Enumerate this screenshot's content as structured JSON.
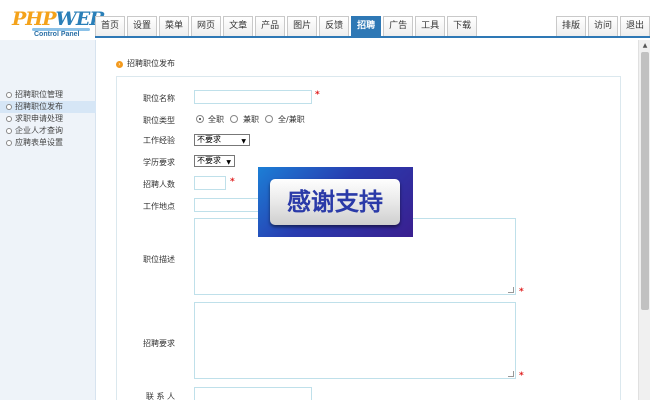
{
  "logo": {
    "main_a": "PHP",
    "main_b": "WEB",
    "sub": "Control Panel"
  },
  "nav": {
    "tabs": [
      {
        "label": "首页"
      },
      {
        "label": "设置"
      },
      {
        "label": "菜单"
      },
      {
        "label": "网页"
      },
      {
        "label": "文章"
      },
      {
        "label": "产品"
      },
      {
        "label": "图片"
      },
      {
        "label": "反馈"
      },
      {
        "label": "招聘",
        "active": true
      },
      {
        "label": "广告"
      },
      {
        "label": "工具"
      },
      {
        "label": "下载"
      }
    ],
    "right_tabs": [
      {
        "label": "排版"
      },
      {
        "label": "访问"
      },
      {
        "label": "退出"
      }
    ]
  },
  "sidebar": {
    "items": [
      {
        "label": "招聘职位管理"
      },
      {
        "label": "招聘职位发布",
        "active": true
      },
      {
        "label": "求职申请处理"
      },
      {
        "label": "企业人才查询"
      },
      {
        "label": "应聘表单设置"
      }
    ]
  },
  "main": {
    "breadcrumb": "招聘职位发布",
    "breadcrumb_icon": "arrow-circle-icon",
    "form": {
      "position_name_label": "职位名称",
      "job_type_label": "职位类型",
      "job_type_options": [
        "全职",
        "兼职",
        "全/兼职"
      ],
      "job_type_selected": "全职",
      "experience_label": "工作经验",
      "experience_value": "不要求",
      "education_label": "学历要求",
      "education_value": "不要求",
      "headcount_label": "招聘人数",
      "location_label": "工作地点",
      "description_label": "职位描述",
      "requirements_label": "招聘要求",
      "contact_label": "联 系 人",
      "required_mark": "*"
    }
  },
  "overlay": {
    "text": "感谢支持"
  },
  "colors": {
    "accent": "#2e78b5",
    "logo_orange": "#f4a21a",
    "required": "#e02020"
  }
}
